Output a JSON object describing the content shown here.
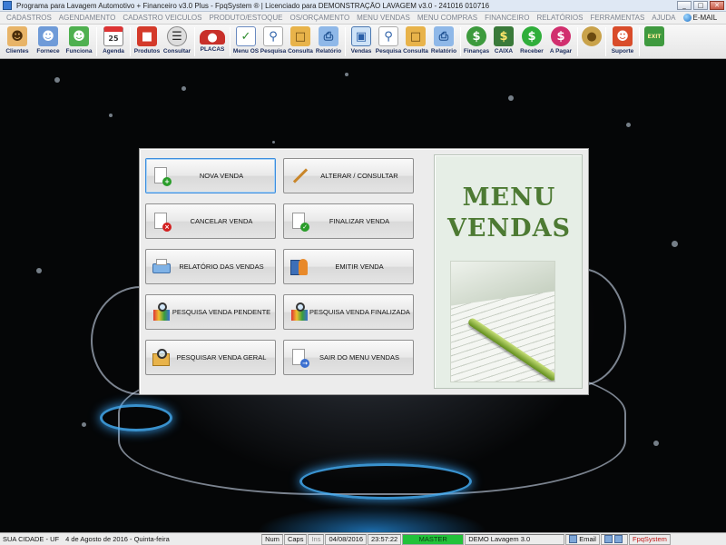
{
  "window": {
    "title": "Programa para Lavagem Automotivo + Financeiro v3.0 Plus - FpqSystem ® | Licenciado para  DEMONSTRAÇÃO LAVAGEM v3.0 - 241016 010716",
    "min": "_",
    "max": "□",
    "close": "✕"
  },
  "menu": {
    "items": [
      "CADASTROS",
      "AGENDAMENTO",
      "CADASTRO VEICULOS",
      "PRODUTO/ESTOQUE",
      "OS/ORÇAMENTO",
      "MENU VENDAS",
      "MENU COMPRAS",
      "FINANCEIRO",
      "RELATÓRIOS",
      "FERRAMENTAS",
      "AJUDA"
    ],
    "email": "E-MAIL"
  },
  "toolbar": {
    "clientes": "Clientes",
    "fornece": "Fornece",
    "funciona": "Funciona",
    "agenda": "Agenda",
    "agenda_day": "25",
    "produtos": "Produtos",
    "consultar": "Consultar",
    "placas": "PLACAS",
    "menu_os": "Menu OS",
    "pesquisa1": "Pesquisa",
    "consulta1": "Consulta",
    "relatorio1": "Relatório",
    "vendas": "Vendas",
    "pesquisa2": "Pesquisa",
    "consulta2": "Consulta",
    "relatorio2": "Relatório",
    "financas": "Finanças",
    "caixa": "CAIXA",
    "receber": "Receber",
    "a_pagar": "A Pagar",
    "suporte": "Suporte",
    "exit": "EXIT"
  },
  "dialog": {
    "buttons": {
      "nova_venda": "NOVA VENDA",
      "alterar_consultar": "ALTERAR / CONSULTAR",
      "cancelar_venda": "CANCELAR VENDA",
      "finalizar_venda": "FINALIZAR VENDA",
      "relatorio_vendas": "RELATÓRIO DAS VENDAS",
      "emitir_venda": "EMITIR VENDA",
      "pesquisa_pendente": "PESQUISA VENDA PENDENTE",
      "pesquisa_finalizada": "PESQUISA VENDA FINALIZADA",
      "pesquisar_geral": "PESQUISAR VENDA GERAL",
      "sair_menu": "SAIR DO MENU VENDAS"
    },
    "panel_title_line1": "MENU",
    "panel_title_line2": "VENDAS"
  },
  "status": {
    "location": "SUA CIDADE - UF",
    "date_long": "4 de Agosto de 2016 - Quinta-feira",
    "num": "Num",
    "caps": "Caps",
    "ins": "Ins",
    "date": "04/08/2016",
    "time": "23:57:22",
    "master": "MASTER",
    "demo": "DEMO Lavagem 3.0",
    "email": "Email",
    "brand": "FpqSystem"
  },
  "colors": {
    "panel_title": "#4d7a33",
    "master_bar": "#22c23a",
    "brand_text": "#c01515"
  }
}
